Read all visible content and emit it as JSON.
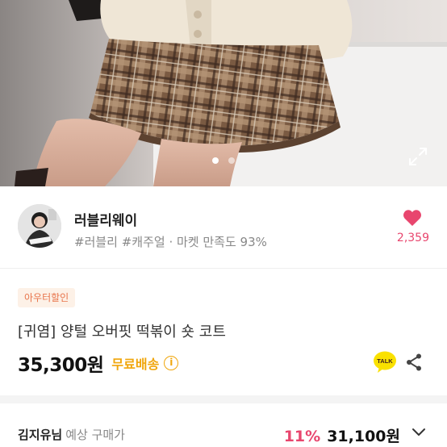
{
  "seller": {
    "name": "러블리웨이",
    "tags": "#러블리 #캐주얼 · 마켓 만족도 93%",
    "like_count": "2,359"
  },
  "product": {
    "badge": "아우터할인",
    "title": "[귀염] 양털 오버핏 떡볶이 숏 코트",
    "price": "35,300원",
    "shipping": "무료배송",
    "info_icon_label": "i",
    "talk_label": "TALK"
  },
  "expected": {
    "user": "김지유님",
    "label": "예상 구매가",
    "discount": "11%",
    "price": "31,100원"
  },
  "gallery": {
    "slide_count": 2,
    "active_index": 0
  },
  "colors": {
    "accent_pink": "#e8466e",
    "badge_orange": "#e8744b",
    "shipping_yellow": "#f0a60c",
    "talk_yellow": "#fae100"
  },
  "icons": [
    "expand-icon",
    "heart-icon",
    "info-icon",
    "kakao-talk-icon",
    "share-icon",
    "chevron-down-icon"
  ]
}
